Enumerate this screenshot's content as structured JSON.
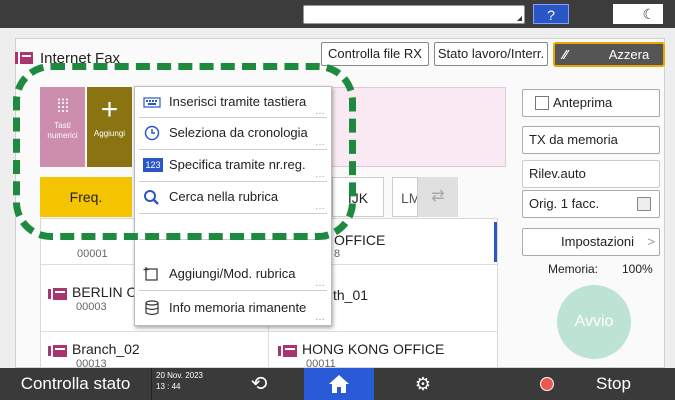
{
  "header": {
    "app_title": "Internet Fax",
    "help_label": "?",
    "moon_label": "☾",
    "btn_controlla_rx": "Controlla file RX",
    "btn_stato_lavoro": "Stato lavoro/Interr.",
    "btn_azzera": "Azzera"
  },
  "tiles": {
    "tasti_numerici": "Tasti numerici",
    "aggiungi": "Aggiungi"
  },
  "tabs": {
    "freq": "Freq.",
    "ijk": "IJK",
    "lm": "LM"
  },
  "menu": {
    "items": [
      {
        "label": "Inserisci tramite tastiera",
        "icon": "keyboard-icon"
      },
      {
        "label": "Seleziona da cronologia",
        "icon": "clock-icon"
      },
      {
        "label": "Specifica tramite nr.reg.",
        "icon": "number-icon"
      },
      {
        "label": "Cerca nella rubrica",
        "icon": "search-icon"
      },
      {
        "label": "Aggiungi/Mod. rubrica",
        "icon": "add-contact-icon"
      },
      {
        "label": "Info memoria rimanente",
        "icon": "memory-icon"
      }
    ],
    "number_badge": "123"
  },
  "list": {
    "entries": [
      {
        "name": "",
        "num": "00001"
      },
      {
        "name": "OFFICE",
        "num": "8"
      },
      {
        "name": "BERLIN O",
        "num": "00003"
      },
      {
        "name": "th_01",
        "num": ""
      },
      {
        "name": "Branch_02",
        "num": "00013"
      },
      {
        "name": "HONG KONG OFFICE",
        "num": "00011"
      }
    ]
  },
  "right_panel": {
    "anteprima": "Anteprima",
    "tx_da_memoria": "TX da memoria",
    "rilev_auto": "Rilev.auto",
    "orig_facc": "Orig. 1 facc.",
    "impostazioni": "Impostazioni",
    "memoria_label": "Memoria:",
    "memoria_value": "100%",
    "avvio": "Avvio"
  },
  "bottom_bar": {
    "status": "Controlla stato",
    "date": "20 Nov. 2023",
    "time": "13 : 44",
    "stop": "Stop"
  },
  "colors": {
    "accent_blue": "#2a56c6",
    "highlight_green": "#1d8a3f",
    "freq_yellow": "#f5c400",
    "azzera_border": "#e8a800",
    "avvio_green": "#bde3d5"
  }
}
